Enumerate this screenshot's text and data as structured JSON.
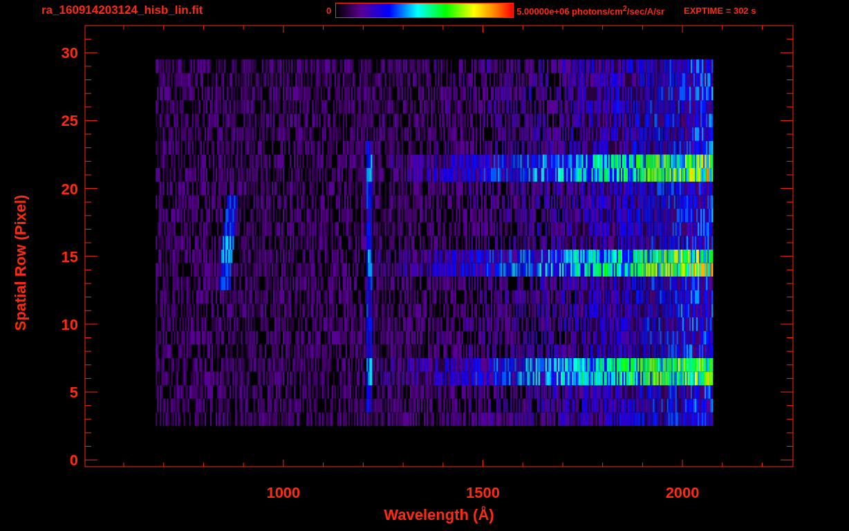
{
  "title": "ra_160914203124_hisb_lin.fit",
  "colorbar": {
    "min_label": "0",
    "max_label": "5.00000e+06 photons/cm$^{2}$/sec/A/sr"
  },
  "exposure": "EXPTIME = 302 s",
  "plot": {
    "xlabel": "Wavelength (Å)",
    "ylabel": "Spatial Row (Pixel)",
    "xtick_labels": [
      "1000",
      "1500",
      "2000"
    ],
    "ytick_labels": [
      "30",
      "25",
      "20",
      "15",
      "10",
      "5",
      "0"
    ]
  }
}
